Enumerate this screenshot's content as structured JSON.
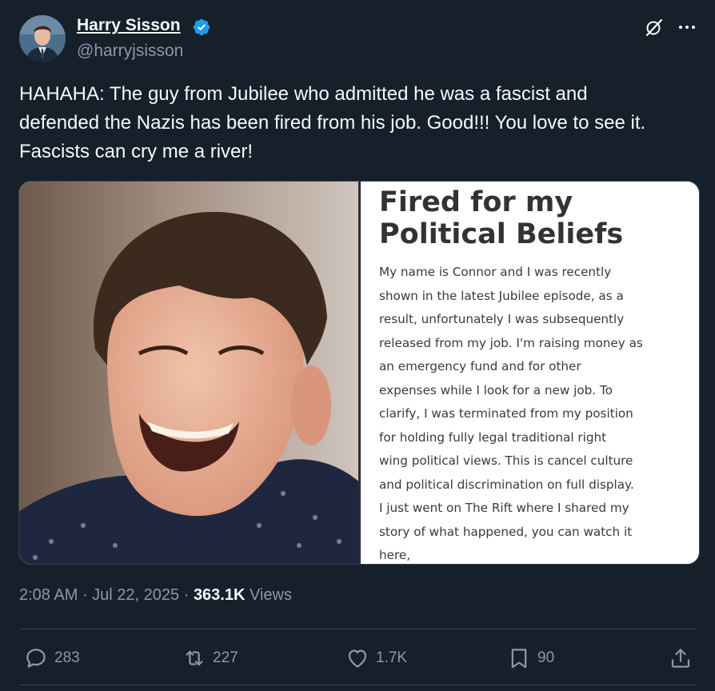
{
  "tweet": {
    "author": {
      "name": "Harry Sisson",
      "handle": "@harryjsisson",
      "verified": true,
      "avatar_icon": "avatar-photo"
    },
    "text_lines": [
      "HAHAHA: The guy from Jubilee who admitted he was a fascist and",
      "defended the Nazis has been fired from his job. Good!!! You love to see it.",
      "Fascists can cry me a river!"
    ],
    "media": {
      "photo_icon": "laughing-man-photo",
      "panel_title_lines": [
        "Fired for my",
        "Political Beliefs"
      ],
      "panel_body_lines": [
        "My name is Connor and I was recently",
        "shown in the latest Jubilee episode, as a",
        "result, unfortunately I was subsequently",
        "released from my job. I'm raising money as",
        "an emergency fund and for other",
        "expenses while I look for a new job. To",
        "clarify, I was terminated from my position",
        "for holding fully legal traditional right",
        "wing political views. This is cancel culture",
        "and political discrimination on full display.",
        "I just went on The Rift where I shared my",
        "story of what happened, you can watch it",
        "here,"
      ]
    },
    "meta": {
      "time": "2:08 AM",
      "sep1": " · ",
      "date": "Jul 22, 2025",
      "sep2": " · ",
      "views_count": "363.1K",
      "views_label": " Views"
    },
    "actions": {
      "replies": "283",
      "reposts": "227",
      "likes": "1.7K",
      "bookmarks": "90"
    }
  },
  "colors": {
    "background": "#15202b",
    "text_primary": "#f7f9f9",
    "text_secondary": "#8b98a5",
    "verified_badge": "#1d9bf0",
    "border": "#38444d"
  }
}
